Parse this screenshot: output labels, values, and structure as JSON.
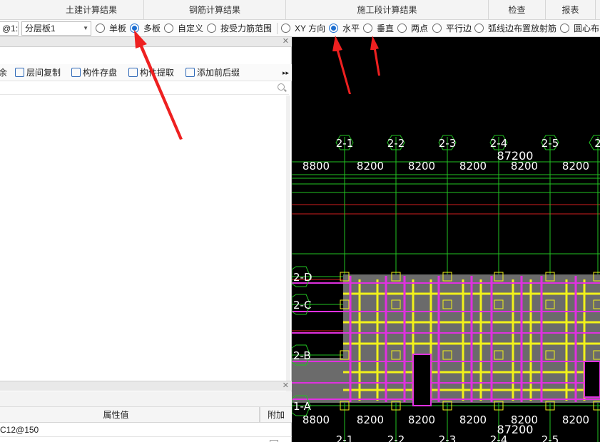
{
  "ribbon": {
    "tabs": [
      "土建计算结果",
      "钢筋计算结果",
      "施工段计算结果",
      "检查",
      "报表"
    ]
  },
  "toolbar": {
    "floor_combo": "@1:",
    "layer_combo": "分层板1",
    "radios": [
      {
        "label": "单板",
        "checked": false
      },
      {
        "label": "多板",
        "checked": true
      },
      {
        "label": "自定义",
        "checked": false
      },
      {
        "label": "按受力筋范围",
        "checked": false
      },
      {
        "label": "XY 方向",
        "checked": false
      },
      {
        "label": "水平",
        "checked": true
      },
      {
        "label": "垂直",
        "checked": false
      },
      {
        "label": "两点",
        "checked": false
      },
      {
        "label": "平行边",
        "checked": false
      },
      {
        "label": "弧线边布置放射筋",
        "checked": false
      },
      {
        "label": "圆心布",
        "checked": false
      }
    ]
  },
  "left_panel": {
    "toolbar": {
      "delete_partial": "余",
      "floor_copy": "层间复制",
      "component_store": "构件存盘",
      "component_extract": "构件提取",
      "add_prefix": "添加前后缀"
    }
  },
  "properties": {
    "header_value": "属性值",
    "header_extra": "附加",
    "rows": [
      {
        "value": "C12@150"
      }
    ]
  },
  "cad": {
    "top_axes": [
      "2-1",
      "2-2",
      "2-3",
      "2-4",
      "2-5",
      "2"
    ],
    "bottom_axes": [
      "2-1",
      "2-2",
      "2-3",
      "2-4",
      "2-5"
    ],
    "spans": [
      "8800",
      "8200",
      "8200",
      "8200",
      "8200",
      "8200"
    ],
    "total": "87200",
    "row_axes": [
      "2-D",
      "2-C",
      "2-B",
      "1-A"
    ]
  }
}
